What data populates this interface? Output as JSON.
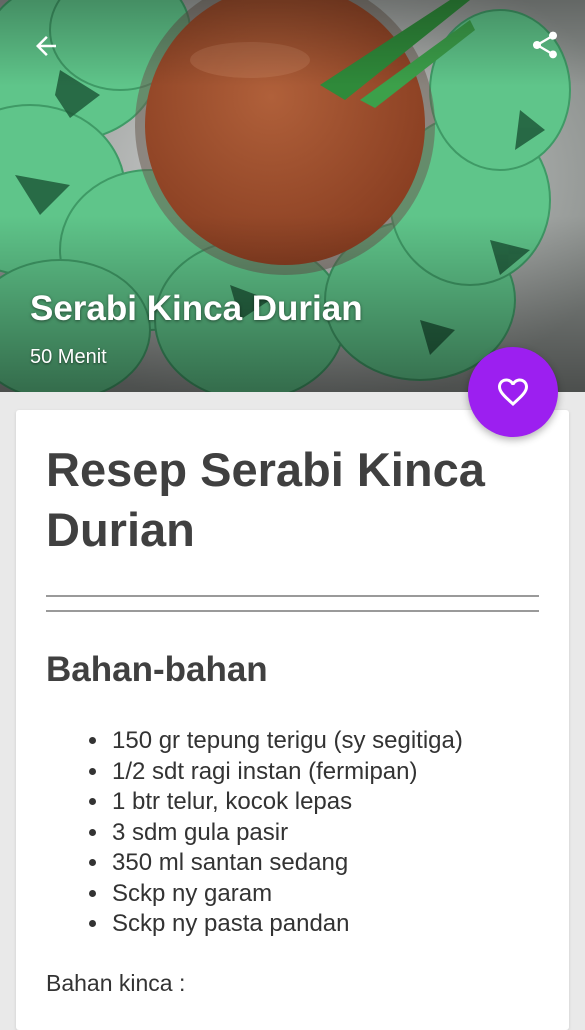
{
  "header": {
    "back_icon": "arrow-left-icon",
    "share_icon": "share-icon",
    "title": "Serabi Kinca Durian",
    "duration": "50 Menit",
    "favorite_icon": "heart-outline-icon"
  },
  "colors": {
    "accent": "#9c1ff0",
    "card_bg": "#ffffff",
    "page_bg": "#e9e9e9",
    "title_text": "#404040"
  },
  "recipe": {
    "title": "Resep Serabi Kinca Durian",
    "ingredients_heading": "Bahan-bahan",
    "ingredients": [
      "150 gr tepung terigu (sy segitiga)",
      "1/2 sdt ragi instan (fermipan)",
      "1 btr telur, kocok lepas",
      "3 sdm gula pasir",
      "350 ml santan sedang",
      "Sckp ny garam",
      "Sckp ny pasta pandan"
    ],
    "kinca_heading": "Bahan kinca :"
  }
}
